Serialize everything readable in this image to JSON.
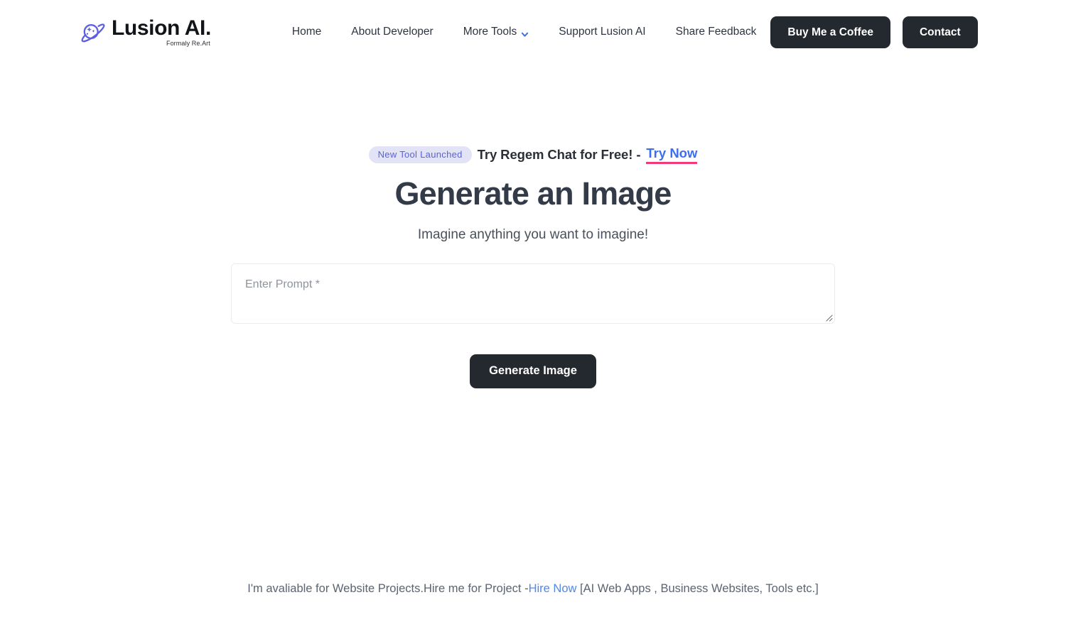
{
  "header": {
    "brand": {
      "icon": "planet-sparkle-icon",
      "name": "Lusion AI.",
      "tagline": "Formaly Re.Art"
    },
    "nav": [
      {
        "label": "Home",
        "name": "nav-item-home",
        "has_chevron": false
      },
      {
        "label": "About Developer",
        "name": "nav-item-about-developer",
        "has_chevron": false
      },
      {
        "label": "More Tools",
        "name": "nav-item-more-tools",
        "has_chevron": true,
        "chevron_icon": "chevron-down-icon"
      },
      {
        "label": "Support Lusion AI",
        "name": "nav-item-support-lusion-ai",
        "has_chevron": false
      },
      {
        "label": "Share Feedback",
        "name": "nav-item-share-feedback",
        "has_chevron": false
      }
    ],
    "actions": {
      "buy_coffee_label": "Buy Me a Coffee",
      "contact_label": "Contact"
    }
  },
  "main": {
    "announcement": {
      "badge": "New Tool Launched",
      "text": "Try Regem Chat for Free! -",
      "link_label": "Try Now"
    },
    "title": "Generate an Image",
    "subtitle": "Imagine anything you want to imagine!",
    "prompt": {
      "placeholder": "Enter Prompt *",
      "value": "",
      "resize_handle": "resize-grip-icon"
    },
    "generate_label": "Generate Image"
  },
  "footer": {
    "text_before": "I'm avaliable for Website Projects.Hire me for Project -",
    "link_label": "Hire Now",
    "text_after": " [AI Web Apps , Business Websites, Tools etc.]"
  },
  "colors": {
    "accent_dark": "#242930",
    "brand_purple": "#5b63d3",
    "link_blue": "#3c6ef0",
    "underline_pink": "#ef3c77",
    "badge_bg": "#e3e3f8",
    "page_bg": "#ffffff"
  }
}
